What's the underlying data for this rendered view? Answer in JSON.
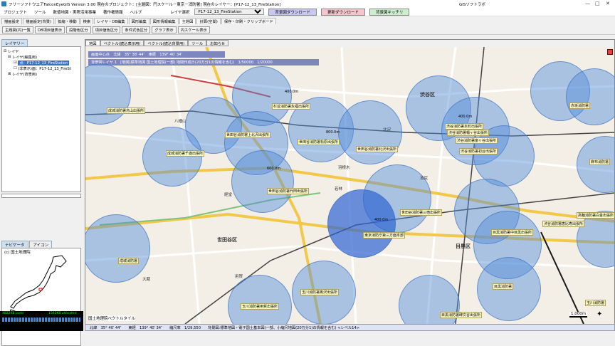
{
  "window": {
    "title": "フリーソフトウエアFalconEyeGIS Version 3.00 現在のプロジェクト：[主題図：円スケール－東京－消防署] 現在のレイヤー：[P17-12_13_FireStation]",
    "vendor": "GISソフトラボ"
  },
  "menu": {
    "items": [
      "プロジェクト",
      "ツール",
      "数値地図・実際活用事業",
      "著作権情報",
      "ヘルプ"
    ],
    "layer_select_label": "レイヤ選択",
    "layer_select_value": "P17-12_13_FireStation",
    "btn_download_bg": "背景図ダウンロード",
    "btn_download_update": "更新ダウンロード",
    "btn_bg_clear": "背景図キッチリ"
  },
  "toolbar_tabs": [
    "描画設定",
    "描画設定(背景)",
    "拡縮・移動",
    "検索",
    "レイヤ・DB編集",
    "図形編集",
    "図形情報編集",
    "主題図",
    "計算(空間)",
    "保存・印刷・クリップボード"
  ],
  "toolbar_tabs_active": "主題図",
  "toolbar_buttons": [
    "主題図(円)一覧",
    "DB項目値表示",
    "段階色区分",
    "項目値色区分",
    "条件式色区分",
    "グラフ表示",
    "円スケール表示"
  ],
  "left_panel": {
    "tab_layers": "レイヤリー",
    "tree": {
      "root": "レイヤ",
      "group_edit": "レイヤ(編集用)",
      "selected_layer": "点：P17-12_13_FireStation",
      "hidden_layer": "(非表示)面：P17-12_13_FireSt",
      "group_bg": "レイヤ(背景用)"
    },
    "nav_tab": "ナビゲータ",
    "icon_tab": "アイコン",
    "credit": "(c) 国土地理院",
    "status_left": "4822KB used",
    "status_right": "1562KB allocated"
  },
  "map_tabs": [
    "地図",
    "ベクトル(読込表示用)",
    "ベクトル(読込背景用)",
    "ツール",
    "お知らせ"
  ],
  "map": {
    "info_line1": "画面中心点　北緯　35° 38′ 44″　東経　139° 40′ 34″",
    "info_line2": "背景図レイヤ 1　[地図]標準地図 国土地理院(一部) 地図作成日(20万分1の情報を含む)　1/50000　1/20000",
    "places": [
      "世田谷区",
      "渋谷区",
      "目黒区",
      "大蔵",
      "若林",
      "羽根木",
      "経堂",
      "用賀",
      "八幡山",
      "池尻",
      "北沢"
    ],
    "distances": [
      "400.0m",
      "800.0m",
      "600.0m",
      "400.0m",
      "400.0m"
    ],
    "stations": [
      "成城消防署烏山出張所",
      "杉並消防署永福出張所",
      "世田谷消防署上北沢出張所",
      "世田谷消防署松原出張所",
      "世田谷消防署北沢出張所",
      "成城消防署千歳出張所",
      "渋谷消防署本町出張所",
      "渋谷消防署幡ヶ谷出張所",
      "渋谷消防署初台出張所",
      "渋谷消防署富ヶ谷出張所",
      "世田谷消防署代田出張所",
      "世田谷消防署三宿出張所",
      "東京消防庁第三方面本部",
      "成城消防署",
      "玉川消防署奥沢出張所",
      "玉川消防署用賀出張所",
      "目黒消防署中目黒出張所",
      "渋谷消防署恵比寿出張所",
      "目黒消防署",
      "目黒消防署碑文谷出張所",
      "赤坂消防署",
      "麻布消防署",
      "高輪消防署白金出張所",
      "玉川消防署"
    ],
    "scale_label": "1,000m",
    "credit": "国土地理院ベクトルタイル",
    "colors": {
      "circle": "#508cdc",
      "circle_dark": "#2d64d2",
      "label_bg": "#fffbc8"
    }
  },
  "statusbar": {
    "lat": "北緯　35° 40′ 44″",
    "lon": "東経　139° 40′ 34″",
    "scale": "縮尺率　1/29,550",
    "bg_info": "背景図:標準地図・電子国土基本図(一部、小縮尺地図(20万分1)の情報を含む) <レベル14>"
  }
}
